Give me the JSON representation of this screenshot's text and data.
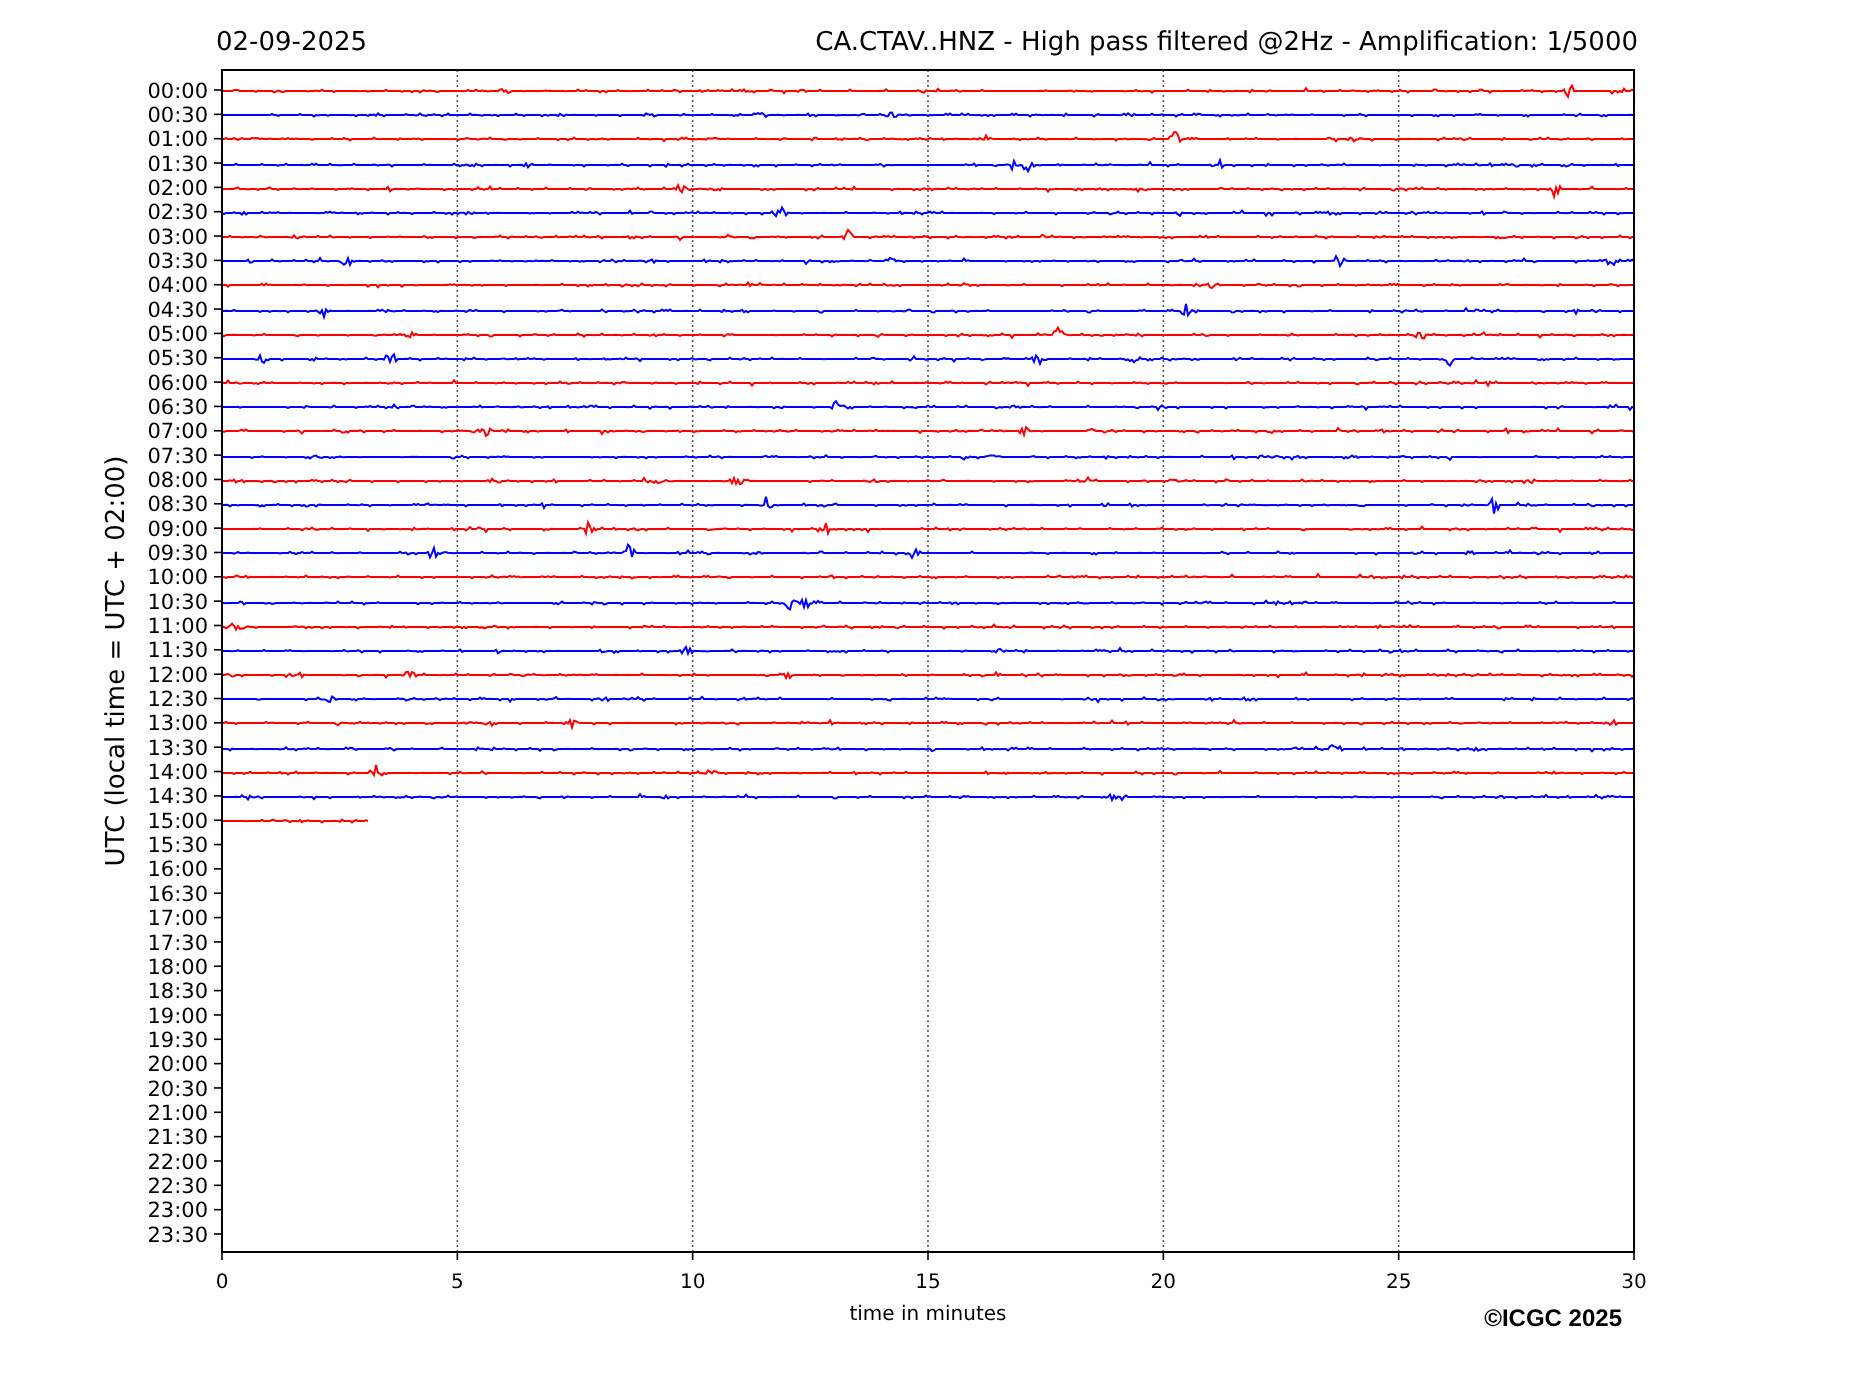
{
  "header": {
    "date": "02-09-2025",
    "title": "CA.CTAV..HNZ - High pass filtered @2Hz - Amplification: 1/5000"
  },
  "plot": {
    "ylabel": "UTC (local time = UTC + 02:00)",
    "xlabel": "time in minutes",
    "xticks": [
      "0",
      "5",
      "10",
      "15",
      "20",
      "25",
      "30"
    ],
    "rows": [
      {
        "label": "00:00",
        "color": "#ff0000",
        "level": 1
      },
      {
        "label": "00:30",
        "color": "#0000ff",
        "level": 1
      },
      {
        "label": "01:00",
        "color": "#ff0000",
        "level": 1
      },
      {
        "label": "01:30",
        "color": "#0000ff",
        "level": 1
      },
      {
        "label": "02:00",
        "color": "#ff0000",
        "level": 1
      },
      {
        "label": "02:30",
        "color": "#0000ff",
        "level": 1
      },
      {
        "label": "03:00",
        "color": "#ff0000",
        "level": 1
      },
      {
        "label": "03:30",
        "color": "#0000ff",
        "level": 1
      },
      {
        "label": "04:00",
        "color": "#ff0000",
        "level": 1
      },
      {
        "label": "04:30",
        "color": "#0000ff",
        "level": 1
      },
      {
        "label": "05:00",
        "color": "#ff0000",
        "level": 1
      },
      {
        "label": "05:30",
        "color": "#0000ff",
        "level": 1
      },
      {
        "label": "06:00",
        "color": "#ff0000",
        "level": 1
      },
      {
        "label": "06:30",
        "color": "#0000ff",
        "level": 1
      },
      {
        "label": "07:00",
        "color": "#ff0000",
        "level": 1
      },
      {
        "label": "07:30",
        "color": "#0000ff",
        "level": 1
      },
      {
        "label": "08:00",
        "color": "#ff0000",
        "level": 1
      },
      {
        "label": "08:30",
        "color": "#0000ff",
        "level": 1
      },
      {
        "label": "09:00",
        "color": "#ff0000",
        "level": 1
      },
      {
        "label": "09:30",
        "color": "#0000ff",
        "level": 1
      },
      {
        "label": "10:00",
        "color": "#ff0000",
        "level": 1
      },
      {
        "label": "10:30",
        "color": "#0000ff",
        "level": 1
      },
      {
        "label": "11:00",
        "color": "#ff0000",
        "level": 1
      },
      {
        "label": "11:30",
        "color": "#0000ff",
        "level": 1
      },
      {
        "label": "12:00",
        "color": "#ff0000",
        "level": 1
      },
      {
        "label": "12:30",
        "color": "#0000ff",
        "level": 1
      },
      {
        "label": "13:00",
        "color": "#ff0000",
        "level": 1
      },
      {
        "label": "13:30",
        "color": "#0000ff",
        "level": 1
      },
      {
        "label": "14:00",
        "color": "#ff0000",
        "level": 1
      },
      {
        "label": "14:30",
        "color": "#0000ff",
        "level": 1
      },
      {
        "label": "15:00",
        "color": "#ff0000",
        "level": 0.103
      },
      {
        "label": "15:30"
      },
      {
        "label": "16:00"
      },
      {
        "label": "16:30"
      },
      {
        "label": "17:00"
      },
      {
        "label": "17:30"
      },
      {
        "label": "18:00"
      },
      {
        "label": "18:30"
      },
      {
        "label": "19:00"
      },
      {
        "label": "19:30"
      },
      {
        "label": "20:00"
      },
      {
        "label": "20:30"
      },
      {
        "label": "21:00"
      },
      {
        "label": "21:30"
      },
      {
        "label": "22:00"
      },
      {
        "label": "22:30"
      },
      {
        "label": "23:00"
      },
      {
        "label": "23:30"
      }
    ]
  },
  "copyright": "©ICGC 2025"
}
